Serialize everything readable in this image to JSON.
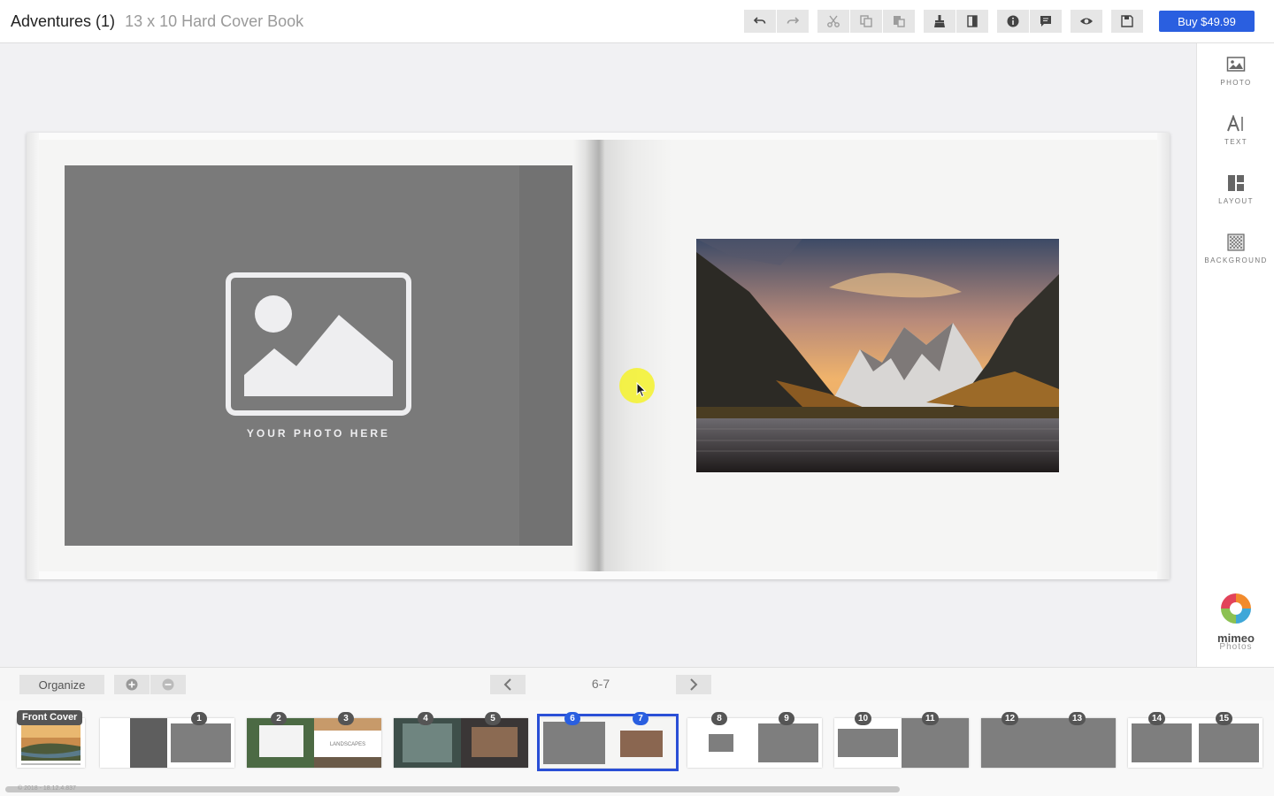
{
  "header": {
    "title": "Adventures (1)",
    "subtitle": "13 x 10 Hard Cover Book",
    "buy_label": "Buy $49.99"
  },
  "toolbar_icons": [
    "undo-icon",
    "redo-icon",
    "cut-icon",
    "copy-icon",
    "paste-icon",
    "clean-icon",
    "page-flip-icon",
    "info-icon",
    "comment-icon",
    "preview-icon",
    "save-icon"
  ],
  "right_tools": [
    {
      "label": "PHOTO",
      "icon": "photo-icon"
    },
    {
      "label": "TEXT",
      "icon": "text-icon"
    },
    {
      "label": "LAYOUT",
      "icon": "layout-icon"
    },
    {
      "label": "BACKGROUND",
      "icon": "background-icon"
    }
  ],
  "brand": {
    "name": "mimeo",
    "sub": "Photos"
  },
  "spread": {
    "placeholder_text": "YOUR PHOTO HERE"
  },
  "bottom": {
    "organize_label": "Organize",
    "page_indicator": "6-7"
  },
  "thumbnails": {
    "cover_label": "Front Cover",
    "pages": [
      "1",
      "2",
      "3",
      "4",
      "5",
      "6",
      "7",
      "8",
      "9",
      "10",
      "11",
      "12",
      "13",
      "14",
      "15"
    ],
    "landscapes_label": "LANDSCAPES",
    "selected_spread": "6-7"
  },
  "footer": {
    "version": "© 2018 - 18.12.4.837"
  },
  "colors": {
    "accent": "#2a5fe0",
    "placeholder_grey": "#7a7a7a",
    "cursor_highlight": "#f4f22c"
  }
}
